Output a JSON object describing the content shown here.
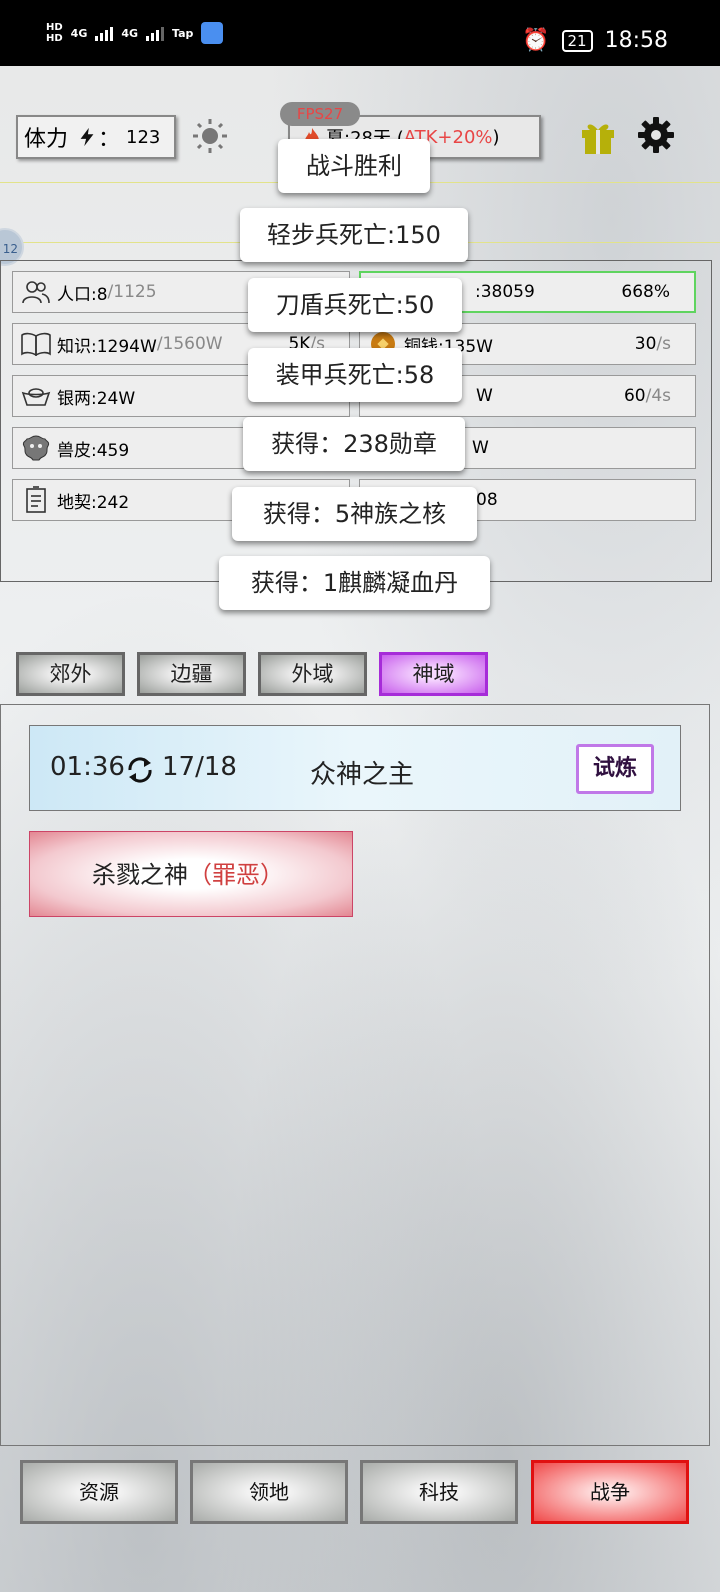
{
  "status_bar": {
    "network_1": "HD",
    "network_2": "HD",
    "net_type_1": "4G",
    "net_type_2": "4G",
    "app_label": "Tap",
    "battery": "21",
    "time": "18:58"
  },
  "top_bar": {
    "stamina_label": "体力",
    "stamina_sep": "：",
    "stamina_value": "123",
    "fps_label": "FPS27",
    "season_text": "夏:28天 (",
    "season_bonus": "ATK+20%",
    "season_close": ")",
    "side_bubble": "12"
  },
  "resources": {
    "left": [
      {
        "label": "人口:8",
        "secondary": "/1125",
        "rate": "",
        "icon": "people-icon"
      },
      {
        "label": "知识:1294W",
        "secondary": "/1560W",
        "rate": "5K",
        "rate_unit": "/s",
        "icon": "book-icon"
      },
      {
        "label": "银两:24W",
        "secondary": "",
        "rate": "",
        "icon": "silver-ingot-icon"
      },
      {
        "label": "兽皮:459",
        "secondary": "",
        "rate": "",
        "icon": "beast-hide-icon"
      },
      {
        "label": "地契:242",
        "secondary": "",
        "rate": "",
        "icon": "land-deed-icon"
      }
    ],
    "right": [
      {
        "label": ":38059",
        "rate": "668%",
        "icon": "food-icon"
      },
      {
        "label": "铜钱:135W",
        "rate": "30",
        "rate_unit": "/s",
        "icon": "copper-coin-icon"
      },
      {
        "label": "W",
        "rate": "60",
        "rate_unit": "/4s",
        "icon": "gold-icon"
      },
      {
        "label": "W",
        "rate": "",
        "icon": "iron-icon"
      },
      {
        "label": "08",
        "rate": "",
        "icon": "scroll-icon"
      }
    ]
  },
  "toasts": [
    "战斗胜利",
    "轻步兵死亡:150",
    "刀盾兵死亡:50",
    "装甲兵死亡:58",
    "获得：238勋章",
    "获得：5神族之核",
    "获得：1麒麟凝血丹"
  ],
  "tabs": [
    {
      "label": "郊外",
      "active": false
    },
    {
      "label": "边疆",
      "active": false
    },
    {
      "label": "外域",
      "active": false
    },
    {
      "label": "神域",
      "active": true
    }
  ],
  "boss": {
    "timer": "01:36",
    "count": "17/18",
    "name": "众神之主",
    "button": "试炼"
  },
  "god_card": {
    "name": "杀戮之神",
    "tag": "（罪恶）"
  },
  "bottom_nav": [
    {
      "label": "资源",
      "active": false
    },
    {
      "label": "领地",
      "active": false
    },
    {
      "label": "科技",
      "active": false
    },
    {
      "label": "战争",
      "active": true
    }
  ],
  "colors": {
    "accent_purple": "#a62cd8",
    "war_red": "#e01010",
    "bonus_red": "#e84646",
    "gift_yellow": "#b6b00a"
  }
}
